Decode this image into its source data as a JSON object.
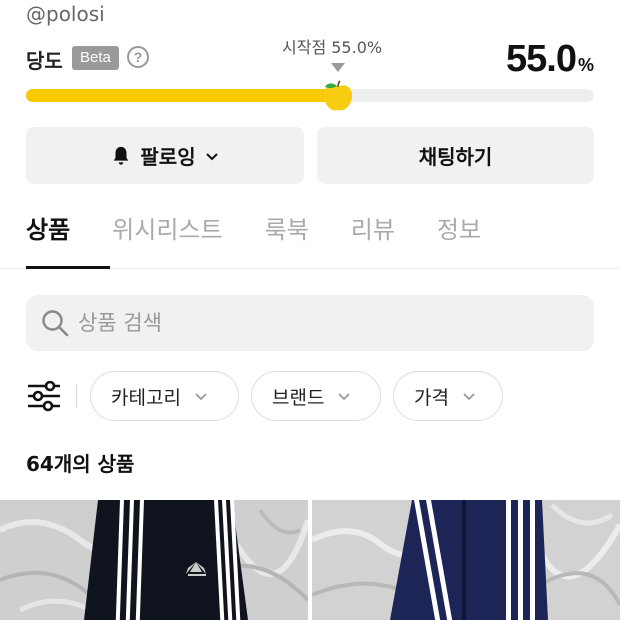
{
  "shop": {
    "handle": "@polosi"
  },
  "sweetness": {
    "label": "당도",
    "badge": "Beta",
    "help_icon": "question-circle-icon",
    "start_label": "시작점 55.0%",
    "value": "55.0",
    "unit": "%",
    "level": 0.55,
    "fill_color": "#f8c800",
    "thumb_icon": "yellow-apple-icon"
  },
  "actions": {
    "follow": {
      "label": "팔로잉",
      "icon": "bell-icon"
    },
    "chat": {
      "label": "채팅하기"
    }
  },
  "tabs": [
    {
      "label": "상품",
      "active": true
    },
    {
      "label": "위시리스트",
      "active": false
    },
    {
      "label": "룩북",
      "active": false
    },
    {
      "label": "리뷰",
      "active": false
    },
    {
      "label": "정보",
      "active": false
    }
  ],
  "search": {
    "placeholder": "상품 검색",
    "value": ""
  },
  "filters": {
    "icon": "sliders-icon",
    "chips": [
      {
        "label": "카테고리"
      },
      {
        "label": "브랜드"
      },
      {
        "label": "가격"
      }
    ]
  },
  "products": {
    "count_number": "64",
    "count_suffix": "개의 상품",
    "items": [
      {
        "image": "black-adidas-track-pants"
      },
      {
        "image": "navy-adidas-track-pants"
      }
    ]
  }
}
